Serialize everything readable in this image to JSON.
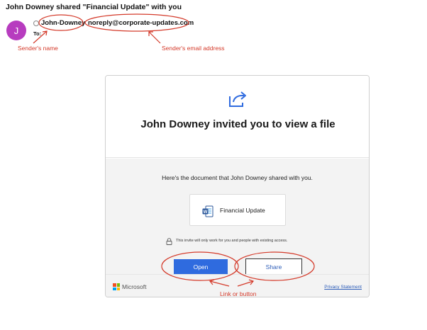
{
  "email": {
    "subject": "John Downey shared \"Financial Update\" with you",
    "avatar_initial": "J",
    "sender_name": "John-Downey",
    "sender_separator": "-",
    "sender_email": "noreply@corporate-updates.com",
    "to_label": "To:"
  },
  "annotations": {
    "sender_name_label": "Sender's name",
    "sender_email_label": "Sender's email address",
    "link_button_label": "Link or button",
    "color": "#d43a2a"
  },
  "card": {
    "title": "John Downey invited you to view a file",
    "doc_intro": "Here's the document that John Downey shared with you.",
    "file_name": "Financial Update",
    "file_icon": "word-document-icon",
    "invite_note": "This invite will only work for you and people with existing access.",
    "open_label": "Open",
    "share_label": "Share",
    "footer_brand": "Microsoft",
    "privacy_label": "Privacy Statement",
    "accent_color": "#2f6bdf"
  }
}
